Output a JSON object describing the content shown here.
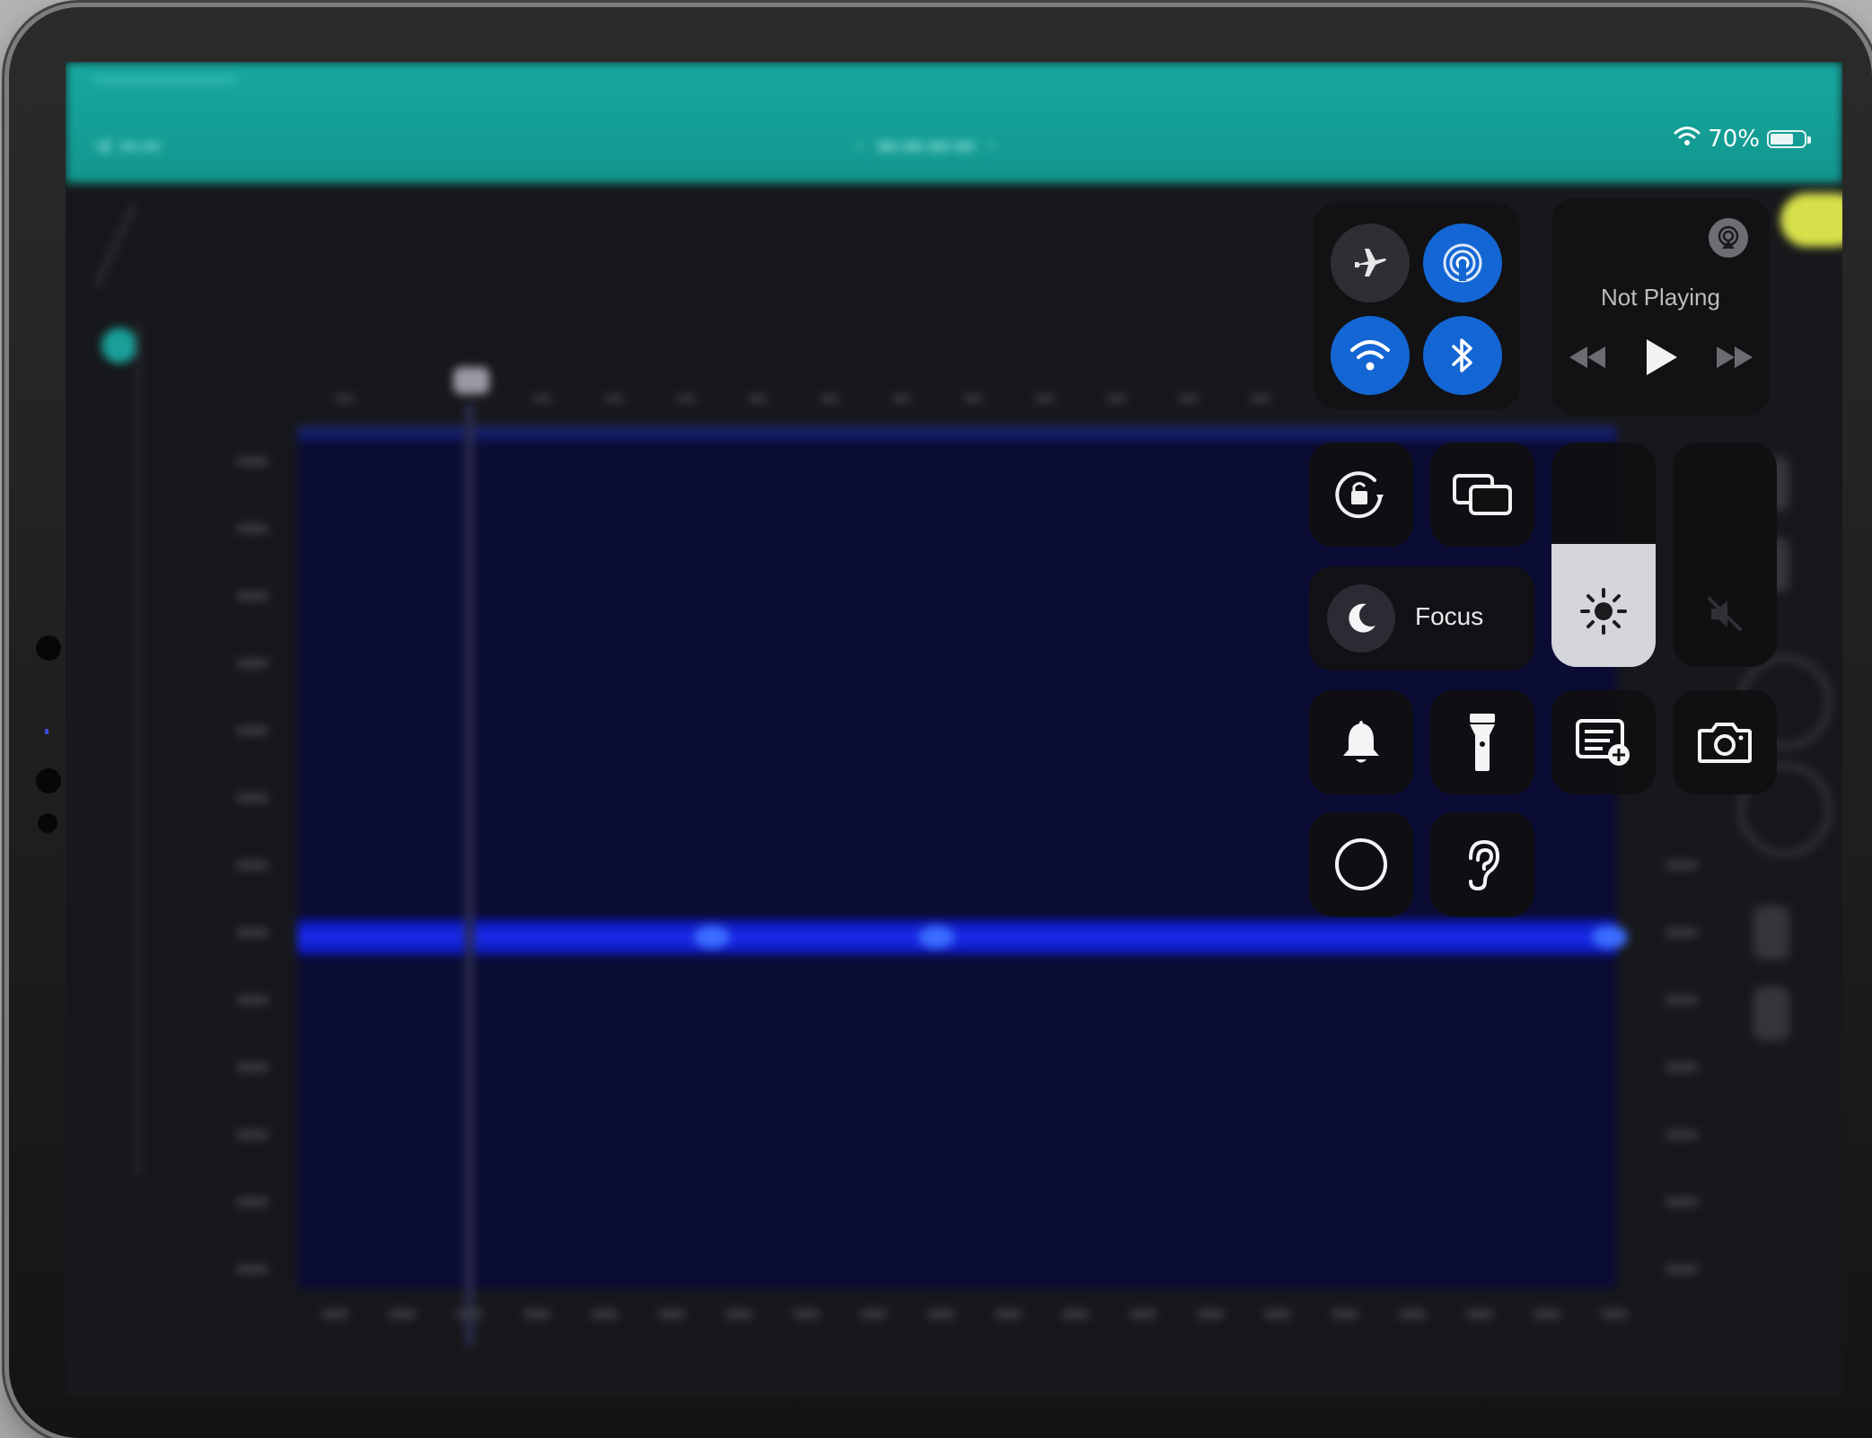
{
  "status_bar": {
    "battery_text": "70%",
    "battery_level": 0.7
  },
  "control_center": {
    "connectivity": {
      "airplane_mode": false,
      "airdrop": true,
      "wifi": true,
      "bluetooth": true
    },
    "now_playing": {
      "label": "Not Playing"
    },
    "focus": {
      "label": "Focus"
    },
    "brightness_level": 0.55,
    "volume_level": 0.0,
    "icons": [
      "airplane-icon",
      "airdrop-icon",
      "wifi-icon",
      "bluetooth-icon",
      "airplay-icon",
      "rewind-icon",
      "play-icon",
      "fast-forward-icon",
      "rotation-lock-icon",
      "screen-mirroring-icon",
      "moon-icon",
      "sun-icon",
      "speaker-muted-icon",
      "bell-icon",
      "flashlight-icon",
      "quick-note-icon",
      "camera-icon",
      "screen-record-icon",
      "hearing-icon"
    ]
  },
  "colors": {
    "app_header": "#16a89f",
    "accent_blue": "#1466d4",
    "spectrogram_bg": "#0b0c33",
    "signal_band": "#1a2df0"
  }
}
